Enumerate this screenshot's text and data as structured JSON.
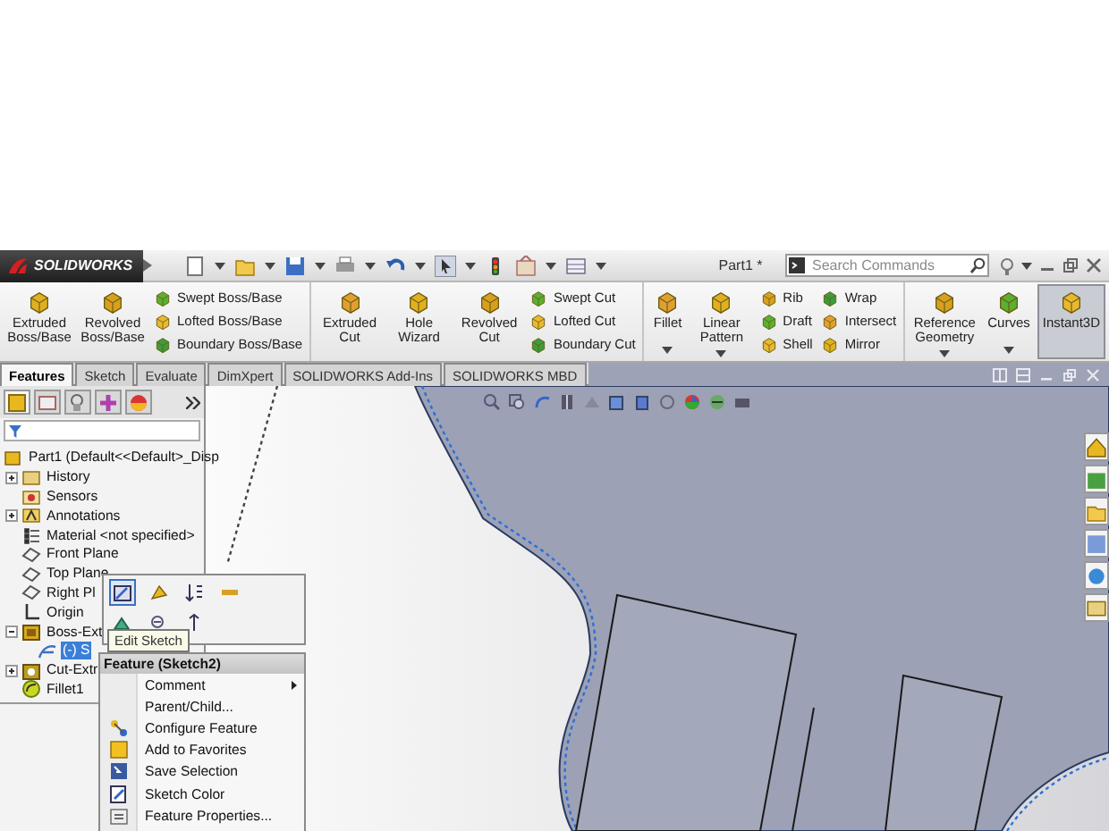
{
  "title_bar": {
    "logo": "SOLIDWORKS",
    "document_title": "Part1 *",
    "search": {
      "placeholder": "Search Commands"
    }
  },
  "ribbon": {
    "groups": [
      {
        "items": [
          {
            "kind": "large",
            "label": "Extruded Boss/Base",
            "dropdown": false,
            "pressed": false
          },
          {
            "kind": "large",
            "label": "Revolved Boss/Base",
            "dropdown": false,
            "pressed": false
          },
          {
            "kind": "stack",
            "entries": [
              "Swept Boss/Base",
              "Lofted Boss/Base",
              "Boundary Boss/Base"
            ]
          }
        ]
      },
      {
        "items": [
          {
            "kind": "large",
            "label": "Extruded Cut",
            "dropdown": false,
            "pressed": false
          },
          {
            "kind": "large",
            "label": "Hole Wizard",
            "dropdown": false,
            "pressed": false
          },
          {
            "kind": "large",
            "label": "Revolved Cut",
            "dropdown": false,
            "pressed": false
          },
          {
            "kind": "stack",
            "entries": [
              "Swept Cut",
              "Lofted Cut",
              "Boundary Cut"
            ]
          }
        ]
      },
      {
        "items": [
          {
            "kind": "large",
            "label": "Fillet",
            "dropdown": true,
            "pressed": false
          },
          {
            "kind": "large",
            "label": "Linear Pattern",
            "dropdown": true,
            "pressed": false
          },
          {
            "kind": "stack",
            "entries": [
              "Rib",
              "Draft",
              "Shell"
            ]
          },
          {
            "kind": "stack",
            "entries": [
              "Wrap",
              "Intersect",
              "Mirror"
            ]
          }
        ]
      },
      {
        "items": [
          {
            "kind": "large",
            "label": "Reference Geometry",
            "dropdown": true,
            "pressed": false
          },
          {
            "kind": "large",
            "label": "Curves",
            "dropdown": true,
            "pressed": false
          },
          {
            "kind": "large",
            "label": "Instant3D",
            "dropdown": false,
            "pressed": true
          }
        ]
      }
    ]
  },
  "tabs": [
    {
      "label": "Features",
      "selected": true
    },
    {
      "label": "Sketch",
      "selected": false
    },
    {
      "label": "Evaluate",
      "selected": false
    },
    {
      "label": "DimXpert",
      "selected": false
    },
    {
      "label": "SOLIDWORKS Add-Ins",
      "selected": false
    },
    {
      "label": "SOLIDWORKS MBD",
      "selected": false
    }
  ],
  "feature_tree": {
    "panel_tabs": [
      {
        "selected": true
      },
      {
        "selected": false
      },
      {
        "selected": false
      },
      {
        "selected": false
      },
      {
        "selected": false
      }
    ],
    "items": [
      {
        "label": "Part1  (Default<<Default>_Disp",
        "kind": "root",
        "selected": false,
        "children": [
          {
            "label": "History",
            "kind": "collapsed",
            "selected": false
          },
          {
            "label": "Sensors",
            "kind": "leaf",
            "selected": false
          },
          {
            "label": "Annotations",
            "kind": "collapsed",
            "selected": false
          },
          {
            "label": "Material <not specified>",
            "kind": "leaf",
            "selected": false
          },
          {
            "label": "Front Plane",
            "kind": "leaf",
            "selected": false
          },
          {
            "label": "Top Plane",
            "kind": "leaf",
            "selected": false
          },
          {
            "label": "Right Pl",
            "kind": "leaf",
            "selected": false
          },
          {
            "label": "Origin",
            "kind": "leaf",
            "selected": false
          },
          {
            "label": "Boss-Ext",
            "kind": "expanded",
            "selected": false,
            "children": [
              {
                "label": "(-) S",
                "kind": "leaf",
                "selected": true
              }
            ]
          },
          {
            "label": "Cut-Extr",
            "kind": "collapsed",
            "selected": false
          },
          {
            "label": "Fillet1",
            "kind": "leaf",
            "selected": false
          }
        ]
      }
    ]
  },
  "context_toolbar": {
    "tooltip": "Edit Sketch"
  },
  "context_menu": {
    "title": "Feature (Sketch2)",
    "items": [
      {
        "label": "Comment",
        "submenu": true
      },
      {
        "label": "Parent/Child...",
        "submenu": false
      },
      {
        "label": "Configure Feature",
        "submenu": false
      },
      {
        "label": "Add to Favorites",
        "submenu": false
      },
      {
        "label": "Save Selection",
        "submenu": false
      },
      {
        "label": "Sketch Color",
        "submenu": false
      },
      {
        "label": "Feature Properties...",
        "submenu": false
      }
    ]
  }
}
